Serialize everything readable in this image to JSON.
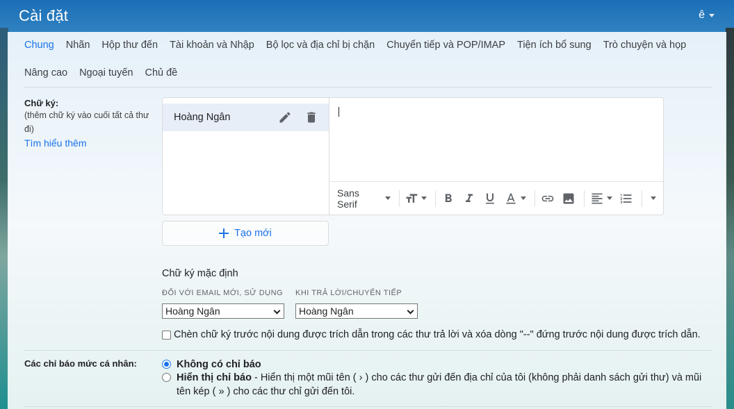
{
  "header": {
    "title": "Cài đặt",
    "lang": "ê"
  },
  "tabs_row1": [
    {
      "label": "Chung",
      "active": true
    },
    {
      "label": "Nhãn"
    },
    {
      "label": "Hộp thư đến"
    },
    {
      "label": "Tài khoản và Nhập"
    },
    {
      "label": "Bộ lọc và địa chỉ bị chặn"
    },
    {
      "label": "Chuyển tiếp và POP/IMAP"
    },
    {
      "label": "Tiện ích bổ sung"
    },
    {
      "label": "Trò chuyện và họp"
    }
  ],
  "tabs_row2": [
    {
      "label": "Nâng cao"
    },
    {
      "label": "Ngoại tuyến"
    },
    {
      "label": "Chủ đề"
    }
  ],
  "signature": {
    "label": "Chữ ký:",
    "sub": "(thêm chữ ký vào cuối tất cả thư đi)",
    "learn_more": "Tìm hiểu thêm",
    "items": [
      {
        "name": "Hoàng Ngân"
      }
    ],
    "font": "Sans Serif",
    "new_button": "Tạo mới",
    "defaults_title": "Chữ ký mặc định",
    "new_email_label": "ĐỐI VỚI EMAIL MỚI, SỬ DỤNG",
    "new_email_value": "Hoàng Ngân",
    "reply_label": "KHI TRẢ LỜI/CHUYỂN TIẾP",
    "reply_value": "Hoàng Ngân",
    "insert_before_quote": "Chèn chữ ký trước nội dung được trích dẫn trong các thư trả lời và xóa dòng \"--\" đứng trước nội dung được trích dẫn."
  },
  "indicators": {
    "label": "Các chỉ báo mức cá nhân:",
    "option_none": "Không có chỉ báo",
    "option_show": "Hiển thị chỉ báo",
    "option_show_desc": " - Hiển thị một mũi tên ( › ) cho các thư gửi đến địa chỉ của tôi (không phải danh sách gửi thư) và mũi tên kép ( » ) cho các thư chỉ gửi đến tôi."
  },
  "colors": {
    "accent": "#1a73e8",
    "selected_item_bg": "#e8eef8"
  }
}
